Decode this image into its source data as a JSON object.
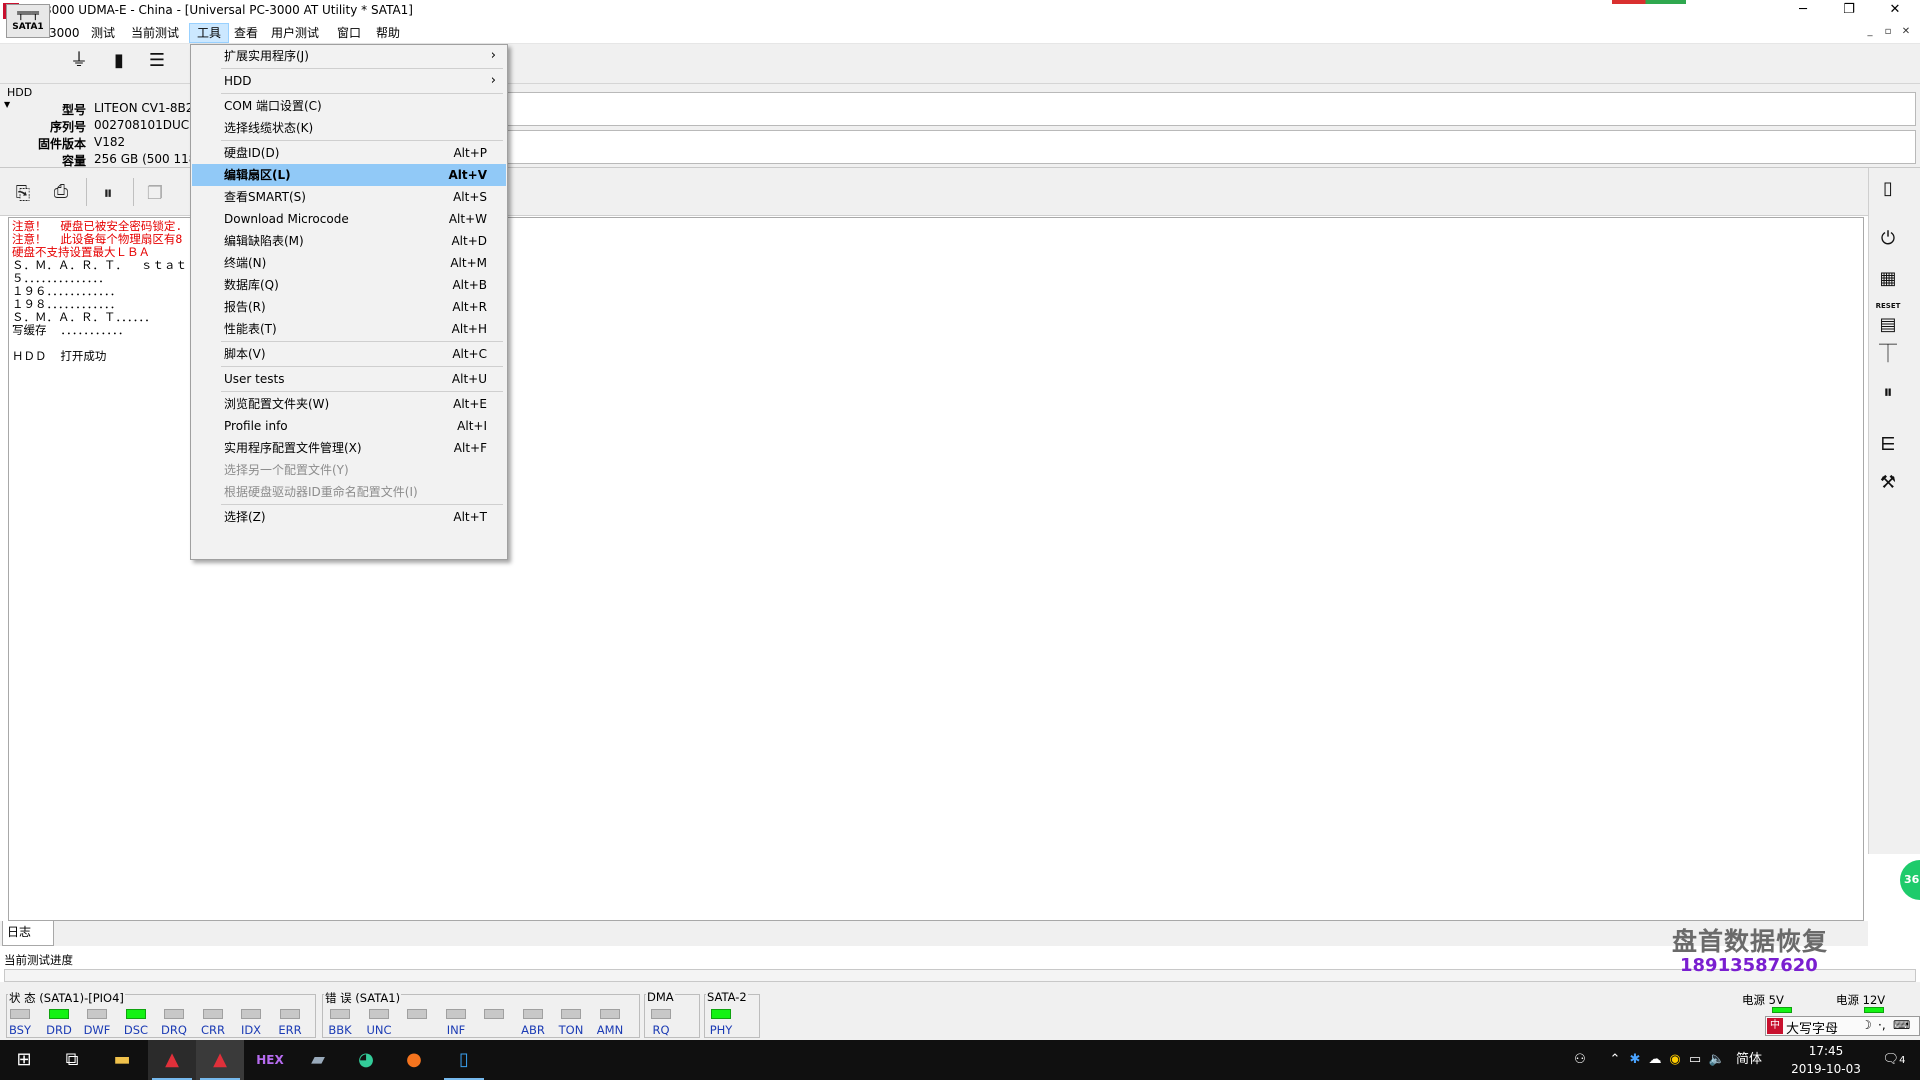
{
  "window": {
    "title": "PC-3000 UDMA-E - China - [Universal PC-3000 AT Utility * SATA1]",
    "app_icon_text": "A",
    "minimize": "─",
    "restore": "❐",
    "close": "✕"
  },
  "menubar": {
    "items": [
      "PC-3000",
      "测试",
      "当前测试",
      "工具",
      "查看",
      "用户测试",
      "窗口",
      "帮助"
    ],
    "active_index": 3,
    "mdi_controls": [
      "_",
      "▫",
      "✕"
    ]
  },
  "toolbar1": {
    "sata_label": "SATA1",
    "icons": [
      "sata-port-icon",
      "power-plug-icon",
      "chip-icon",
      "list-icon"
    ]
  },
  "hdd_info": {
    "legend": "HDD",
    "fields": [
      {
        "label": "型号",
        "value": "LITEON CV1-8B2"
      },
      {
        "label": "序列号",
        "value": "002708101DUC"
      },
      {
        "label": "固件版本",
        "value": "V182"
      },
      {
        "label": "容量",
        "value": "256 GB (500 118"
      }
    ]
  },
  "log": {
    "lines": [
      {
        "text": "注意！  硬盘已被安全密码锁定.",
        "color": "red"
      },
      {
        "text": "注意！  此设备每个物理扇区有8",
        "color": "red"
      },
      {
        "text": "硬盘不支持设置最大ＬＢＡ",
        "color": "red"
      },
      {
        "text": "Ｓ．Ｍ．Ａ．Ｒ．Ｔ．  ｓｔａｔ",
        "color": "black"
      },
      {
        "text": "５．．．．．．．．．．．．．．",
        "color": "black"
      },
      {
        "text": "１９６．．．．．．．．．．．．",
        "color": "black"
      },
      {
        "text": "１９８．．．．．．．．．．．．",
        "color": "black"
      },
      {
        "text": "Ｓ．Ｍ．Ａ．Ｒ．Ｔ．．．．．．",
        "color": "black"
      },
      {
        "text": "写缓存  ．．．．．．．．．．．",
        "color": "black"
      },
      {
        "text": "",
        "color": "black"
      },
      {
        "text": "ＨＤＤ  打开成功",
        "color": "black"
      }
    ]
  },
  "tabs": {
    "log": "日志"
  },
  "progress": {
    "label": "当前测试进度"
  },
  "status_groups": [
    {
      "title": "状 态 (SATA1)-[PIO4]",
      "leds": [
        {
          "label": "BSY",
          "on": false
        },
        {
          "label": "DRD",
          "on": true
        },
        {
          "label": "DWF",
          "on": false
        },
        {
          "label": "DSC",
          "on": true
        },
        {
          "label": "DRQ",
          "on": false
        },
        {
          "label": "CRR",
          "on": false
        },
        {
          "label": "IDX",
          "on": false
        },
        {
          "label": "ERR",
          "on": false
        }
      ]
    },
    {
      "title": "错 误 (SATA1)",
      "leds": [
        {
          "label": "BBK",
          "on": false
        },
        {
          "label": "UNC",
          "on": false
        },
        {
          "label": "",
          "on": false
        },
        {
          "label": "INF",
          "on": false
        },
        {
          "label": "",
          "on": false
        },
        {
          "label": "ABR",
          "on": false
        },
        {
          "label": "TON",
          "on": false
        },
        {
          "label": "AMN",
          "on": false
        }
      ]
    },
    {
      "title": "DMA",
      "leds": [
        {
          "label": "RQ",
          "on": false
        }
      ]
    },
    {
      "title": "SATA-2",
      "leds": [
        {
          "label": "PHY",
          "on": true
        }
      ]
    }
  ],
  "power": {
    "p5v": "电源 5V",
    "p12v": "电源 12V"
  },
  "watermark": {
    "name": "盘首数据恢复",
    "phone": "18913587620"
  },
  "side_badge": "36",
  "ime": {
    "caps": "大写字母",
    "moon": "☽",
    "dots": "·,",
    "kbd": "⌨"
  },
  "taskbar": {
    "apps": [
      "start-icon",
      "task-view-icon",
      "file-explorer-icon",
      "pc3000-icon",
      "pc3000-icon",
      "hex-editor-icon",
      "disk-tool-icon",
      "storage-tool-icon",
      "firefox-icon",
      "phone-app-icon"
    ],
    "tray_ime": "简体",
    "clock_time": "17:45",
    "clock_date": "2019-10-03",
    "notification_count": "4"
  },
  "tools_menu": {
    "items": [
      {
        "label": "扩展实用程序(J)",
        "shortcut": "",
        "submenu": true
      },
      {
        "sep": true
      },
      {
        "label": "HDD",
        "shortcut": "",
        "submenu": true
      },
      {
        "sep": true
      },
      {
        "label": "COM 端口设置(C)",
        "shortcut": ""
      },
      {
        "label": "选择线缆状态(K)",
        "shortcut": ""
      },
      {
        "sep": true
      },
      {
        "label": "硬盘ID(D)",
        "shortcut": "Alt+P"
      },
      {
        "label": "编辑扇区(L)",
        "shortcut": "Alt+V",
        "highlighted": true
      },
      {
        "label": "查看SMART(S)",
        "shortcut": "Alt+S"
      },
      {
        "label": "Download Microcode",
        "shortcut": "Alt+W"
      },
      {
        "label": "编辑缺陷表(M)",
        "shortcut": "Alt+D"
      },
      {
        "label": "终端(N)",
        "shortcut": "Alt+M"
      },
      {
        "label": "数据库(Q)",
        "shortcut": "Alt+B"
      },
      {
        "label": "报告(R)",
        "shortcut": "Alt+R"
      },
      {
        "label": "性能表(T)",
        "shortcut": "Alt+H"
      },
      {
        "sep": true
      },
      {
        "label": "脚本(V)",
        "shortcut": "Alt+C"
      },
      {
        "sep": true
      },
      {
        "label": "User tests",
        "shortcut": "Alt+U"
      },
      {
        "sep": true
      },
      {
        "label": "浏览配置文件夹(W)",
        "shortcut": "Alt+E"
      },
      {
        "label": "Profile info",
        "shortcut": "Alt+I"
      },
      {
        "label": "实用程序配置文件管理(X)",
        "shortcut": "Alt+F"
      },
      {
        "label": "选择另一个配置文件(Y)",
        "shortcut": "",
        "disabled": true
      },
      {
        "label": "根据硬盘驱动器ID重命名配置文件(I)",
        "shortcut": "",
        "disabled": true
      },
      {
        "sep": true
      },
      {
        "label": "选择(Z)",
        "shortcut": "Alt+T"
      }
    ]
  }
}
